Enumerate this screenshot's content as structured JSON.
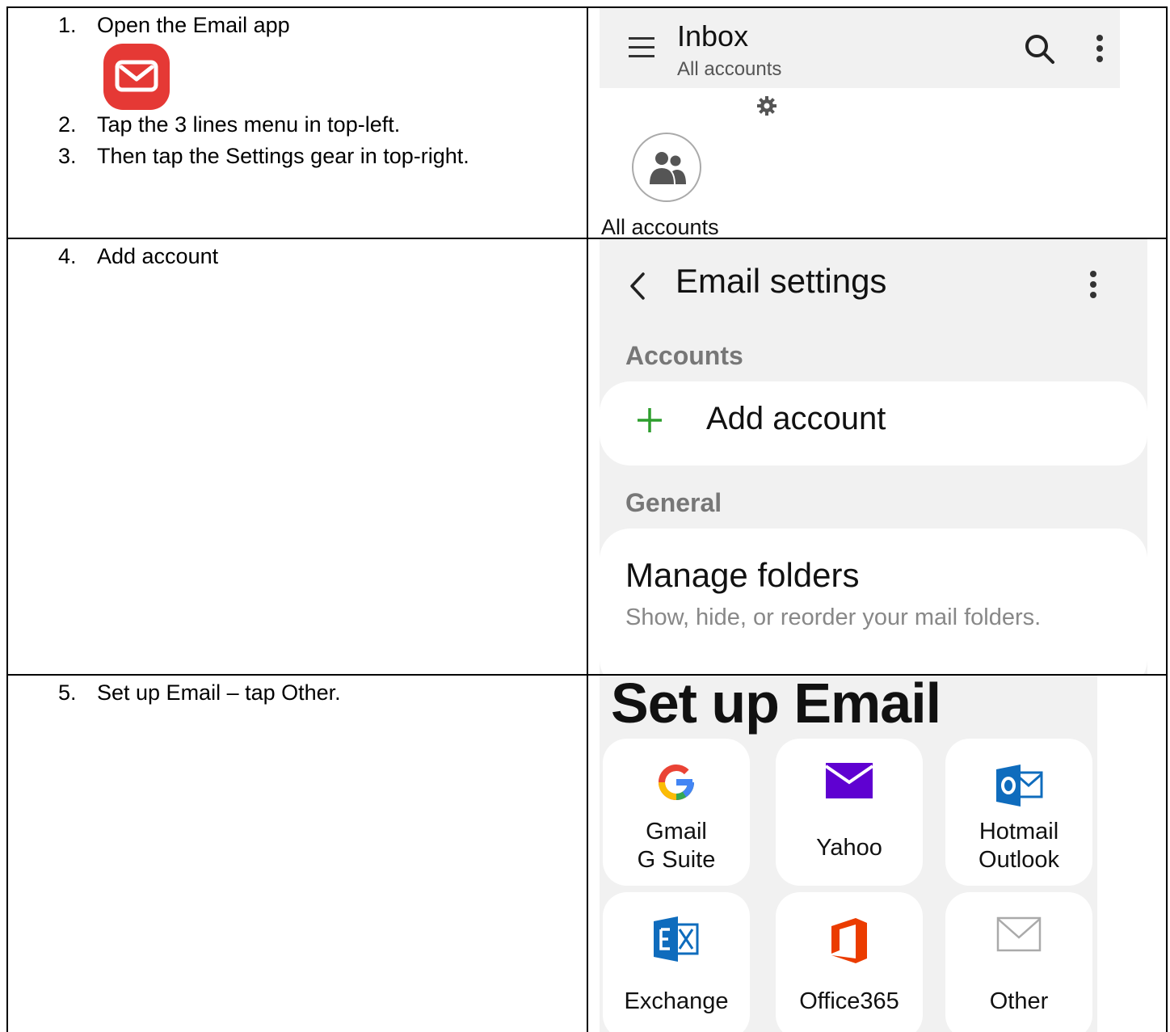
{
  "steps": {
    "s1": {
      "num": "1.",
      "text": "Open the Email app"
    },
    "s2": {
      "num": "2.",
      "text": "Tap the 3 lines menu in top-left."
    },
    "s3": {
      "num": "3.",
      "text": "Then tap the Settings gear in top-right."
    },
    "s4": {
      "num": "4.",
      "text": "Add account"
    },
    "s5": {
      "num": "5.",
      "text": "Set up Email – tap Other."
    }
  },
  "inbox": {
    "title": "Inbox",
    "subtitle": "All accounts",
    "all_accounts_label": "All accounts"
  },
  "settings": {
    "title": "Email settings",
    "accounts_header": "Accounts",
    "add_account": "Add account",
    "general_header": "General",
    "manage_title": "Manage folders",
    "manage_desc": "Show, hide, or reorder your mail folders."
  },
  "setup": {
    "title": "Set up Email",
    "tiles": {
      "gmail": {
        "line1": "Gmail",
        "line2": "G Suite"
      },
      "yahoo": {
        "line1": "Yahoo"
      },
      "hotmail": {
        "line1": "Hotmail",
        "line2": "Outlook"
      },
      "exchange": {
        "line1": "Exchange"
      },
      "office365": {
        "line1": "Office365"
      },
      "other": {
        "line1": "Other"
      }
    }
  },
  "colors": {
    "app_icon": "#e53935",
    "plus_green": "#2e9e2e",
    "yahoo_purple": "#5f01d1",
    "outlook_blue": "#0f6cbd",
    "office_orange": "#eb3c00"
  },
  "icons": [
    "email-app-icon",
    "menu-icon",
    "search-icon",
    "more-vert-icon",
    "gear-icon",
    "people-icon",
    "back-icon",
    "plus-icon",
    "google-icon",
    "yahoo-icon",
    "outlook-icon",
    "exchange-icon",
    "office-icon",
    "envelope-icon"
  ]
}
